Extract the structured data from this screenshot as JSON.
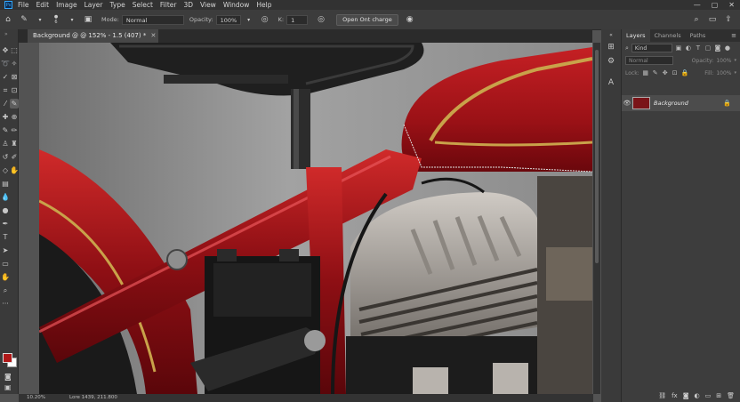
{
  "menu": {
    "items": [
      "File",
      "Edit",
      "Image",
      "Layer",
      "Type",
      "Select",
      "Filter",
      "3D",
      "View",
      "Window",
      "Help"
    ],
    "app_icon": "Ps"
  },
  "options": {
    "brush_size": "6",
    "mode_label": "Mode:",
    "mode_value": "Normal",
    "opacity_label": "Opacity:",
    "opacity_value": "100%",
    "k_label": "K:",
    "k_value": "1",
    "action_button": "Open Ont charge"
  },
  "document": {
    "tab_title": "Background @ @ 152% - 1.5 (407) *"
  },
  "layers_panel": {
    "tabs": [
      "Layers",
      "Channels",
      "Paths"
    ],
    "filter_kind": "Kind",
    "blend_mode": "Normal",
    "opacity_label": "Opacity:",
    "opacity_value": "100%",
    "lock_label": "Lock:",
    "fill_label": "Fill:",
    "fill_value": "100%",
    "layer_name": "Background",
    "footer_icons": [
      "link-icon",
      "fx-icon",
      "mask-icon",
      "adjustment-icon",
      "group-icon",
      "new-layer-icon",
      "trash-icon"
    ]
  },
  "status": {
    "zoom": "10.20%",
    "info": "Lore 1439, 211.800"
  },
  "colors": {
    "foreground": "#b01818",
    "background": "#ffffff",
    "accent": "#31a8ff"
  }
}
